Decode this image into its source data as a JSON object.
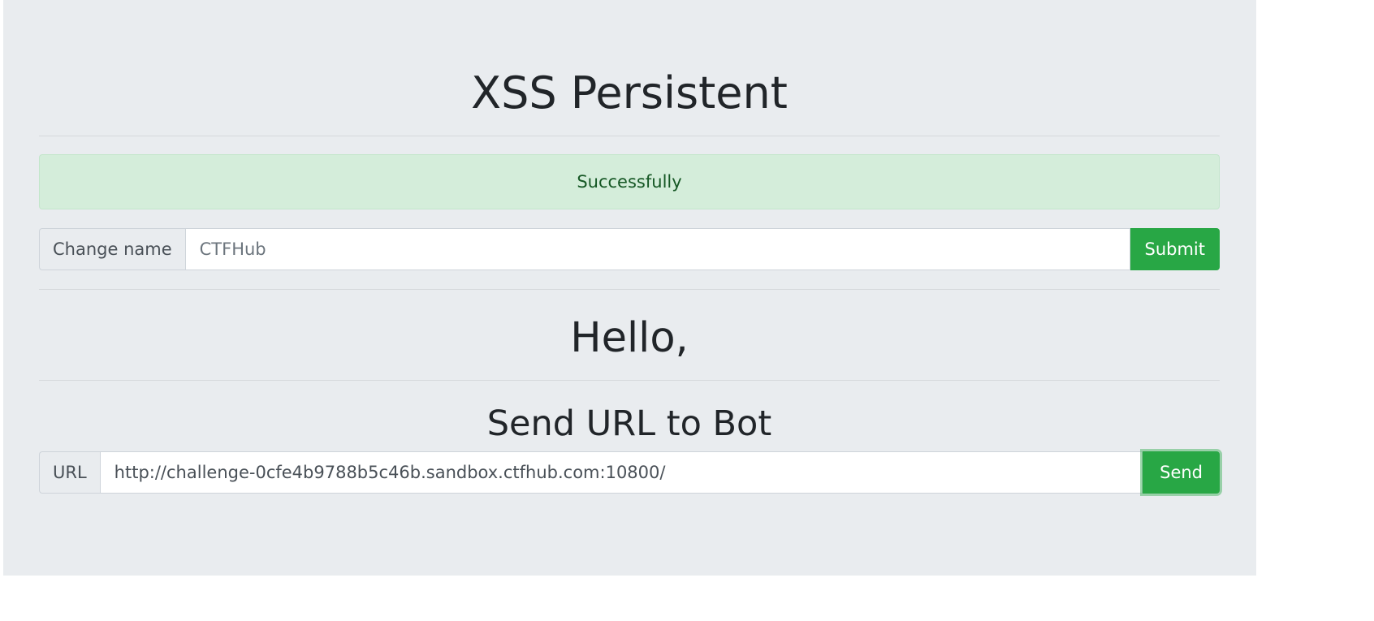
{
  "page": {
    "title": "XSS Persistent",
    "alert_text": "Successfully",
    "change_name": {
      "label": "Change name",
      "placeholder": "CTFHub",
      "button": "Submit"
    },
    "greeting": "Hello,",
    "bot": {
      "heading": "Send URL to Bot",
      "label": "URL",
      "url_value": "http://challenge-0cfe4b9788b5c46b.sandbox.ctfhub.com:10800/",
      "button": "Send"
    }
  },
  "colors": {
    "background": "#e9ecef",
    "alert_bg": "#d4edda",
    "alert_text": "#155724",
    "button": "#28a745"
  }
}
